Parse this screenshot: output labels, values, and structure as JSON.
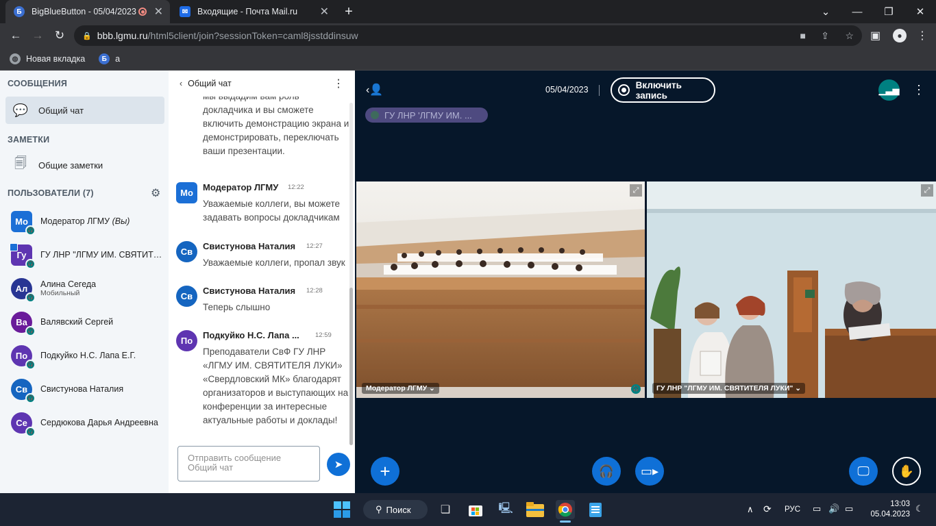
{
  "browser": {
    "tabs": [
      {
        "title": "BigBlueButton - 05/04/2023",
        "favicon": "Б",
        "recording": true
      },
      {
        "title": "Входящие - Почта Mail.ru",
        "favicon": "✉"
      }
    ],
    "url_host": "bbb.lgmu.ru",
    "url_path": "/html5client/join?sessionToken=caml8jsstddinsuw",
    "bookmarks": [
      {
        "label": "Новая вкладка"
      },
      {
        "label": "а",
        "favicon": "Б"
      }
    ]
  },
  "sidebar": {
    "messages_title": "СООБЩЕНИЯ",
    "public_chat": "Общий чат",
    "notes_title": "ЗАМЕТКИ",
    "shared_notes": "Общие заметки",
    "users_title": "ПОЛЬЗОВАТЕЛИ (7)",
    "users": [
      {
        "initials": "Мо",
        "name": "Модератор ЛГМУ",
        "you": "(Вы)",
        "color": "#1b6fd6",
        "moderator": true
      },
      {
        "initials": "Гу",
        "name": "ГУ ЛНР \"ЛГМУ ИМ. СВЯТИТЕЛЯ ЛУКИ\"",
        "color": "#5e35b1",
        "moderator": true,
        "presenter": true
      },
      {
        "initials": "Ал",
        "name": "Алина Сегеда",
        "sub": "Мобильный",
        "color": "#283593"
      },
      {
        "initials": "Ва",
        "name": "Валявский Сергей",
        "color": "#6a1b9a"
      },
      {
        "initials": "По",
        "name": "Подкуйко Н.С. Лапа Е.Г.",
        "color": "#5e35b1"
      },
      {
        "initials": "Св",
        "name": "Свистунова Наталия",
        "color": "#1565c0"
      },
      {
        "initials": "Се",
        "name": "Сердюкова Дарья Андреевна",
        "color": "#5e35b1"
      }
    ]
  },
  "chat": {
    "title": "Общий чат",
    "partial_text": "мы выдадим вам роль докладчика и вы сможете включить демонстрацию экрана и демонстрировать, переключать ваши презентации.",
    "messages": [
      {
        "initials": "Мо",
        "author": "Модератор ЛГМУ",
        "time": "12:22",
        "text": "Уважаемые коллеги, вы можете задавать вопросы докладчикам",
        "color": "#1b6fd6"
      },
      {
        "initials": "Св",
        "author": "Свистунова Наталия",
        "time": "12:27",
        "text": "Уважаемые коллеги, пропал звук",
        "color": "#1565c0"
      },
      {
        "initials": "Св",
        "author": "Свистунова Наталия",
        "time": "12:28",
        "text": "Теперь слышно",
        "color": "#1565c0"
      },
      {
        "initials": "По",
        "author": "Подкуйко Н.С. Лапа ...",
        "time": "12:59",
        "text": "Преподаватели СвФ ГУ ЛНР «ЛГМУ ИМ. СВЯТИТЕЛЯ ЛУКИ» «Свердловский МК» благодарят организаторов и выступающих на конференции за интересные актуальные работы и доклады!",
        "color": "#5e35b1"
      }
    ],
    "input_placeholder": "Отправить сообщение Общий чат"
  },
  "meeting": {
    "date": "05/04/2023",
    "record_label": "Включить запись",
    "talking_pill": "ГУ ЛНР 'ЛГМУ ИМ. ...",
    "videos": [
      {
        "label": "Модератор ЛГМУ"
      },
      {
        "label": "ГУ ЛНР \"ЛГМУ ИМ. СВЯТИТЕЛЯ ЛУКИ\""
      }
    ]
  },
  "taskbar": {
    "search_label": "Поиск",
    "lang": "РУС",
    "time": "13:03",
    "date": "05.04.2023"
  }
}
